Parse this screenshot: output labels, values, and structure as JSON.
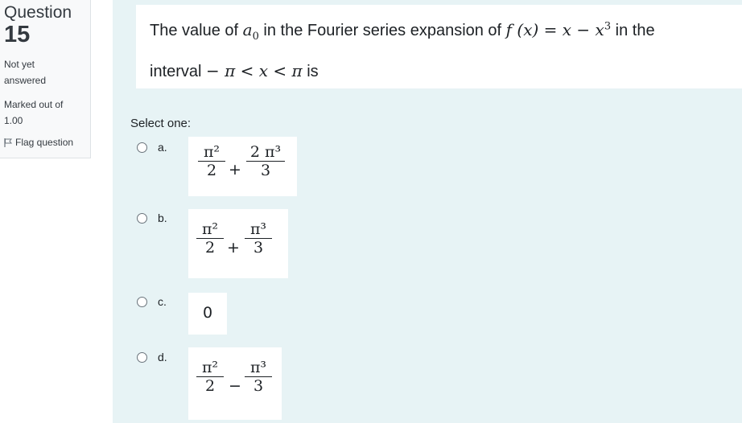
{
  "info": {
    "question_label": "Question",
    "question_number": "15",
    "state_line1": "Not yet",
    "state_line2": "answered",
    "marked_line1": "Marked out of",
    "marked_line2": "1.00",
    "flag_label": "Flag question",
    "flag_icon": "flag-icon"
  },
  "question": {
    "line1_prefix": "The value of ",
    "line1_var": "a",
    "line1_sub": "0",
    "line1_mid": " in the Fourier series expansion of ",
    "line1_fx": "f (x) = x − x",
    "line1_sup": "3",
    "line1_suffix": " in the",
    "line2_prefix": "interval ",
    "line2_math": "− π < x < π",
    "line2_suffix": " is"
  },
  "select_label": "Select one:",
  "options": [
    {
      "letter": "a.",
      "num1": "π²",
      "den1": "2",
      "op": "+",
      "num2": "2 π³",
      "den2": "3"
    },
    {
      "letter": "b.",
      "num1": "π²",
      "den1": "2",
      "op": "+",
      "num2": "π³",
      "den2": "3"
    },
    {
      "letter": "c.",
      "value": "0"
    },
    {
      "letter": "d.",
      "num1": "π²",
      "den1": "2",
      "op": "−",
      "num2": "π³",
      "den2": "3"
    }
  ]
}
